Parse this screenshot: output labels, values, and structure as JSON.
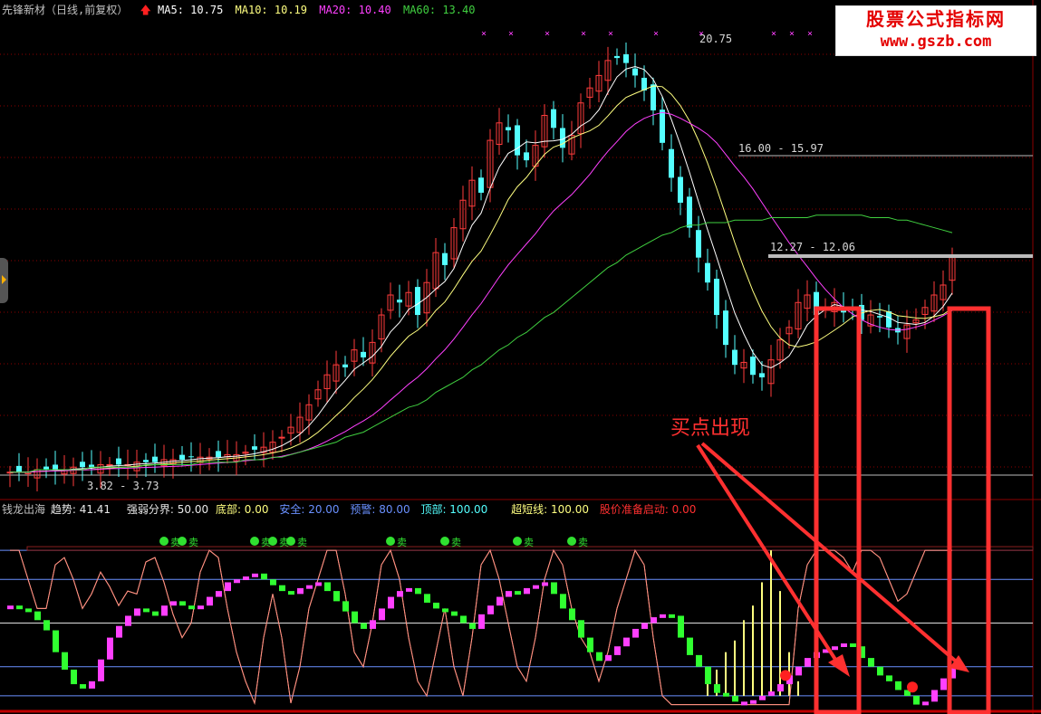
{
  "header": {
    "title": "先锋新材（日线,前复权）",
    "arrow": "🡅",
    "ma5": "MA5: 10.75",
    "ma10": "MA10: 10.19",
    "ma20": "MA20: 10.40",
    "ma60": "MA60: 13.40"
  },
  "watermark": {
    "line1": "股票公式指标网",
    "line2": "www.gszb.com"
  },
  "price_labels": {
    "high": "20.75",
    "level1": "16.00 - 15.97",
    "level2": "12.27 - 12.06",
    "low": "3.82 - 3.73"
  },
  "indicator": {
    "name": "钱龙出海",
    "trend": "趋势: 41.41",
    "strength": "强弱分界: 50.00",
    "bottom": "底部: 0.00",
    "safe": "安全: 20.00",
    "warn": "预警: 80.00",
    "top": "顶部: 100.00",
    "ultra": "超短线: 100.00",
    "ready": "股价准备启动: 0.00"
  },
  "annotation": "买点出现",
  "buy_marker": "买",
  "sell_marker": "卖",
  "colors": {
    "up": "#ff3c3c",
    "down": "#54ffff",
    "ma5": "#ffffff",
    "ma10": "#ffff80",
    "ma20": "#ff40ff",
    "ma60": "#40d040",
    "grid": "#8b0000",
    "ind_up": "#ff40ff",
    "ind_down": "#30ff30",
    "osc": "#ff9080",
    "ultra": "#ffff80",
    "box": "#ff3030"
  },
  "chart_data": {
    "type": "candlestick",
    "price_ylim": [
      3.5,
      22
    ],
    "close": [
      3.8,
      3.8,
      3.8,
      3.9,
      3.9,
      3.9,
      3.9,
      4.0,
      4.0,
      4.0,
      4.1,
      4.1,
      4.1,
      4.1,
      4.2,
      4.2,
      4.2,
      4.3,
      4.3,
      4.3,
      4.4,
      4.4,
      4.4,
      4.4,
      4.5,
      4.5,
      4.6,
      4.7,
      4.8,
      5.0,
      5.2,
      5.6,
      6.0,
      6.5,
      7.1,
      7.7,
      8.1,
      8.0,
      8.7,
      8.4,
      9.0,
      10.1,
      10.9,
      10.6,
      11.0,
      10.1,
      11.4,
      12.6,
      12.1,
      13.6,
      14.7,
      15.5,
      15.0,
      17.1,
      17.8,
      17.5,
      16.5,
      16.3,
      16.9,
      18.1,
      17.6,
      16.8,
      17.3,
      18.6,
      19.2,
      19.7,
      20.3,
      20.4,
      20.2,
      19.7,
      19.1,
      18.3,
      17.0,
      15.6,
      14.6,
      13.6,
      12.4,
      11.4,
      10.1,
      8.9,
      8.1,
      8.2,
      7.7,
      7.6,
      8.3,
      9.1,
      9.6,
      10.6,
      10.9,
      10.1,
      10.4,
      10.6,
      10.2,
      10.4,
      9.9,
      10.1,
      10.0,
      9.6,
      9.4,
      9.7,
      9.9,
      10.4,
      10.9,
      11.3,
      12.4
    ],
    "ma60": [
      3.8,
      3.8,
      3.8,
      3.9,
      3.9,
      3.9,
      3.9,
      3.9,
      3.9,
      4.0,
      4.0,
      4.0,
      4.0,
      4.0,
      4.0,
      4.1,
      4.1,
      4.1,
      4.1,
      4.1,
      4.1,
      4.2,
      4.2,
      4.2,
      4.2,
      4.2,
      4.3,
      4.3,
      4.3,
      4.4,
      4.4,
      4.5,
      4.6,
      4.7,
      4.8,
      4.9,
      5.0,
      5.2,
      5.3,
      5.4,
      5.6,
      5.8,
      6.0,
      6.2,
      6.4,
      6.5,
      6.7,
      7.0,
      7.2,
      7.4,
      7.6,
      7.9,
      8.1,
      8.4,
      8.7,
      8.9,
      9.2,
      9.4,
      9.7,
      10.0,
      10.2,
      10.5,
      10.8,
      11.1,
      11.4,
      11.7,
      12.0,
      12.2,
      12.5,
      12.7,
      12.9,
      13.1,
      13.3,
      13.4,
      13.6,
      13.7,
      13.7,
      13.8,
      13.8,
      13.8,
      13.9,
      13.9,
      13.9,
      13.9,
      14.0,
      14.0,
      14.0,
      14.0,
      14.0,
      14.1,
      14.1,
      14.1,
      14.1,
      14.1,
      14.1,
      14.0,
      14.0,
      14.0,
      13.9,
      13.9,
      13.8,
      13.7,
      13.6,
      13.5,
      13.4
    ],
    "indicator_ylim": [
      -10,
      110
    ],
    "trend": [
      62,
      60,
      58,
      52,
      45,
      30,
      18,
      8,
      5,
      10,
      25,
      40,
      48,
      55,
      60,
      58,
      55,
      62,
      65,
      62,
      60,
      62,
      68,
      72,
      78,
      80,
      82,
      84,
      80,
      76,
      72,
      70,
      74,
      76,
      78,
      72,
      65,
      58,
      50,
      46,
      52,
      60,
      68,
      72,
      74,
      70,
      64,
      60,
      58,
      55,
      50,
      46,
      56,
      62,
      68,
      72,
      70,
      74,
      76,
      78,
      70,
      60,
      52,
      40,
      30,
      24,
      28,
      34,
      40,
      46,
      50,
      54,
      56,
      55,
      40,
      28,
      20,
      8,
      2,
      0,
      -4,
      -4,
      -3,
      0,
      3,
      8,
      14,
      20,
      26,
      30,
      32,
      34,
      36,
      34,
      26,
      20,
      14,
      10,
      4,
      0,
      -6,
      -4,
      4,
      12,
      20
    ],
    "oscillator": [
      100,
      100,
      80,
      60,
      60,
      90,
      95,
      80,
      60,
      70,
      85,
      75,
      62,
      72,
      70,
      92,
      95,
      78,
      56,
      40,
      50,
      85,
      100,
      95,
      60,
      30,
      10,
      -5,
      40,
      70,
      40,
      -5,
      20,
      60,
      80,
      100,
      100,
      70,
      30,
      20,
      50,
      90,
      100,
      80,
      40,
      10,
      0,
      30,
      60,
      20,
      0,
      40,
      90,
      100,
      80,
      50,
      20,
      10,
      40,
      80,
      100,
      90,
      60,
      40,
      30,
      10,
      30,
      60,
      80,
      100,
      90,
      40,
      0,
      -6,
      -6,
      -6,
      -6,
      -6,
      -6,
      -6,
      -6,
      -6,
      -6,
      -6,
      -6,
      -6,
      -6,
      60,
      90,
      100,
      100,
      100,
      95,
      85,
      100,
      100,
      95,
      80,
      65,
      70,
      85,
      100,
      100,
      100,
      100
    ],
    "ultra_short": [
      0,
      0,
      0,
      0,
      0,
      0,
      0,
      0,
      0,
      0,
      0,
      0,
      0,
      0,
      0,
      0,
      0,
      0,
      0,
      0,
      0,
      0,
      0,
      0,
      0,
      0,
      0,
      0,
      0,
      0,
      0,
      0,
      0,
      0,
      0,
      0,
      0,
      0,
      0,
      0,
      0,
      0,
      0,
      0,
      0,
      0,
      0,
      0,
      0,
      0,
      0,
      0,
      0,
      0,
      0,
      0,
      0,
      0,
      0,
      0,
      0,
      0,
      0,
      0,
      0,
      0,
      0,
      0,
      0,
      0,
      0,
      0,
      0,
      0,
      0,
      0,
      0,
      8,
      18,
      30,
      38,
      52,
      62,
      78,
      100,
      72,
      30,
      10,
      0,
      0,
      0,
      0,
      0,
      0,
      0,
      0,
      0,
      0,
      0,
      0,
      0,
      0,
      0,
      0,
      0
    ],
    "buy_points": [
      85,
      99
    ]
  }
}
